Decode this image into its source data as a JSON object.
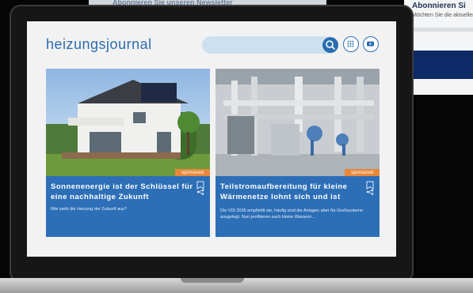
{
  "background": {
    "newsletter_strip": "Abonnieren Sie unseren Newsletter",
    "side_page_title": "Abonnieren Si",
    "side_page_text": "Möchten Sie die aktuellen"
  },
  "header": {
    "logo": "heizungsjournal",
    "search_placeholder": "",
    "search_icon": "search-icon",
    "grid_icon": "grid-icon",
    "video_icon": "youtube-icon"
  },
  "cards": [
    {
      "badge": "sponsored",
      "title": "Sonnenenergie ist der Schlüssel für eine nachhaltige Zukunft",
      "teaser": "Wie sieht die Heizung der Zukunft aus?"
    },
    {
      "badge": "sponsored",
      "title": "Teilstromaufbereitung für kleine Wärmenetze lohnt sich und ist",
      "teaser": "Die VDI 2035 empfiehlt sie, häufig sind die Anlagen aber für Großsysteme ausgelegt. Nun profitieren auch kleine Wassern..."
    }
  ],
  "colors": {
    "brand": "#2a6db1",
    "card_bg": "#2d6fb7",
    "badge": "#e8883a"
  }
}
